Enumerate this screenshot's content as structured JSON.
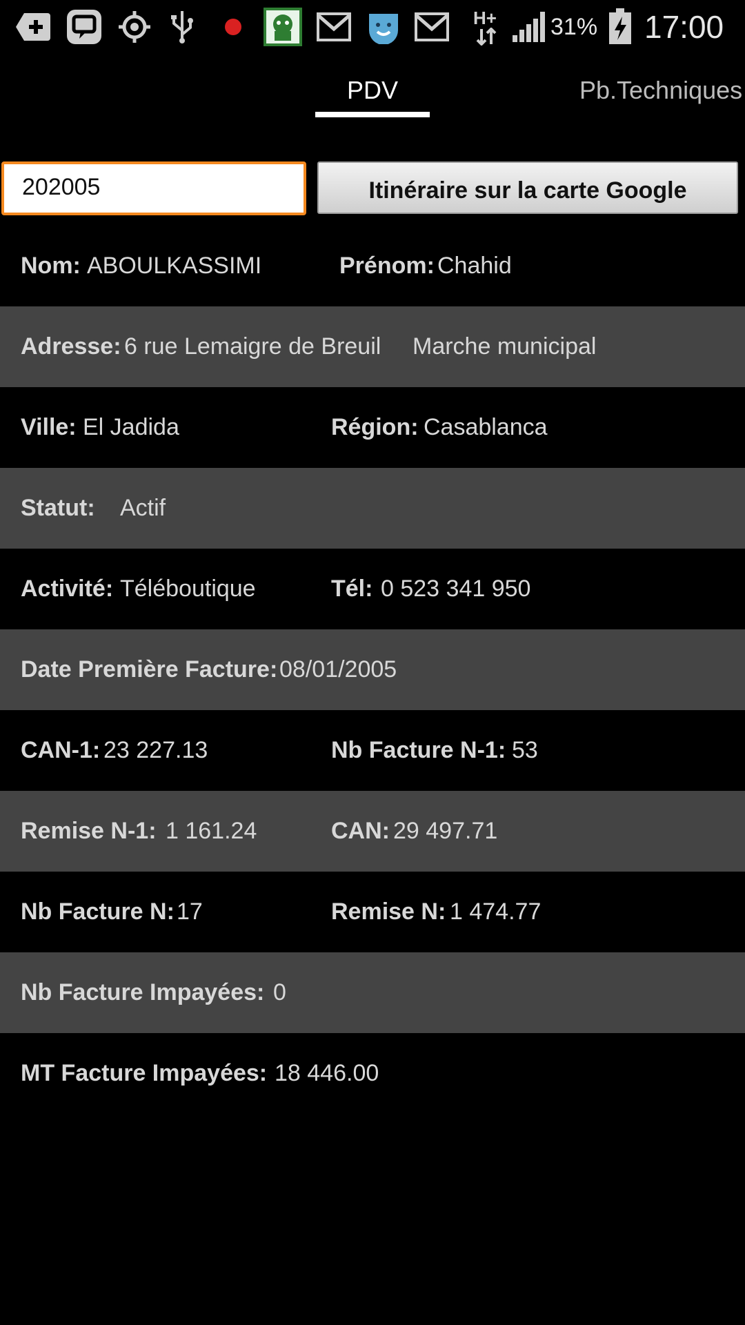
{
  "status_bar": {
    "battery_percent": "31%",
    "time": "17:00",
    "network_label": "H+",
    "icons": [
      "add-box-icon",
      "chat-app-icon",
      "gps-icon",
      "usb-icon",
      "record-dot-icon",
      "android-app-icon",
      "gmail-icon",
      "app-face-icon",
      "gmail-icon",
      "network-h-plus-icon",
      "signal-icon",
      "battery-charging-icon"
    ]
  },
  "tabs": [
    {
      "label": "PDV",
      "selected": true
    },
    {
      "label": "Pb.Techniques",
      "selected": false
    }
  ],
  "search": {
    "value": "202005"
  },
  "map_button_label": "Itinéraire sur la carte Google",
  "rows": {
    "nom": {
      "label": "Nom:",
      "value": "ABOULKASSIMI"
    },
    "prenom": {
      "label": "Prénom:",
      "value": "Chahid"
    },
    "adresse": {
      "label": "Adresse:",
      "value": "6 rue Lemaigre de Breuil",
      "value2": "Marche municipal"
    },
    "ville": {
      "label": "Ville:",
      "value": "El Jadida"
    },
    "region": {
      "label": "Région:",
      "value": "Casablanca"
    },
    "statut": {
      "label": "Statut:",
      "value": "Actif"
    },
    "activite": {
      "label": "Activité:",
      "value": "Téléboutique"
    },
    "tel": {
      "label": "Tél:",
      "value": "0 523 341 950"
    },
    "date_facture": {
      "label": "Date Première Facture:",
      "value": "08/01/2005"
    },
    "can_n1": {
      "label": "CAN-1:",
      "value": "23 227.13"
    },
    "nb_facture_n1": {
      "label": "Nb Facture N-1:",
      "value": "53"
    },
    "remise_n1": {
      "label": "Remise N-1:",
      "value": "1 161.24"
    },
    "can": {
      "label": "CAN:",
      "value": "29 497.71"
    },
    "nb_facture_n": {
      "label": "Nb Facture N:",
      "value": "17"
    },
    "remise_n": {
      "label": "Remise N:",
      "value": "1 474.77"
    },
    "nb_impayees": {
      "label": "Nb Facture Impayées:",
      "value": "0"
    },
    "mt_impayees": {
      "label": "MT Facture Impayées:",
      "value": "18 446.00"
    }
  },
  "colors": {
    "accent_orange": "#f5891f",
    "row_gray": "#444444",
    "background": "#000000"
  }
}
